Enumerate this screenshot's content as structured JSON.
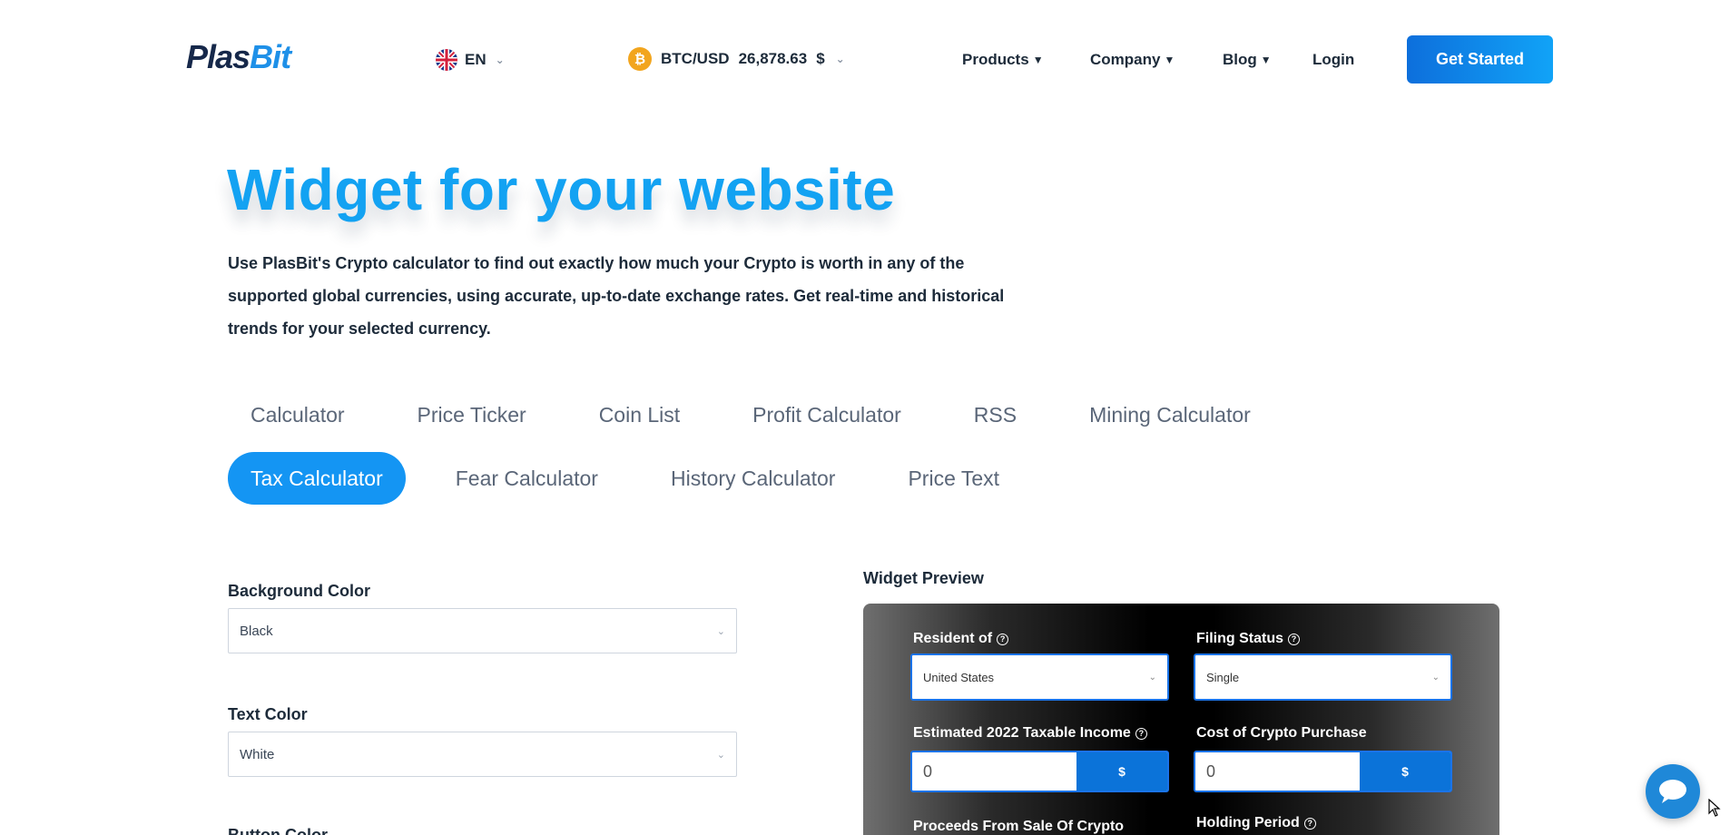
{
  "header": {
    "logo": {
      "part1": "Plas",
      "part2": "Bit"
    },
    "language": "EN",
    "ticker": {
      "pair": "BTC/USD",
      "price": "26,878.63",
      "currency": "$"
    },
    "nav": [
      {
        "label": "Products"
      },
      {
        "label": "Company"
      },
      {
        "label": "Blog"
      },
      {
        "label": "Login"
      }
    ],
    "cta": "Get Started"
  },
  "hero": {
    "title": "Widget for your website",
    "description": "Use PlasBit's Crypto calculator to find out exactly how much your Crypto is worth in any of the supported global currencies, using accurate, up-to-date exchange rates. Get real-time and historical trends for your selected currency."
  },
  "tabs": {
    "row1": [
      "Calculator",
      "Price Ticker",
      "Coin List",
      "Profit Calculator",
      "RSS",
      "Mining Calculator"
    ],
    "row2": [
      "Tax Calculator",
      "Fear Calculator",
      "History Calculator",
      "Price Text"
    ],
    "active": "Tax Calculator"
  },
  "form": {
    "background_color": {
      "label": "Background Color",
      "value": "Black"
    },
    "text_color": {
      "label": "Text Color",
      "value": "White"
    },
    "button_color": {
      "label": "Button Color"
    }
  },
  "preview": {
    "label": "Widget Preview",
    "resident_of": {
      "label": "Resident of",
      "value": "United States"
    },
    "filing_status": {
      "label": "Filing Status",
      "value": "Single"
    },
    "taxable_income": {
      "label": "Estimated 2022 Taxable Income",
      "value": "0",
      "currency": "$"
    },
    "cost_purchase": {
      "label": "Cost of Crypto Purchase",
      "value": "0",
      "currency": "$"
    },
    "proceeds": {
      "label": "Proceeds From Sale Of Crypto"
    },
    "holding_period": {
      "label": "Holding Period"
    }
  },
  "colors": {
    "brand_blue": "#1495f3",
    "logo_dark": "#16284a"
  }
}
